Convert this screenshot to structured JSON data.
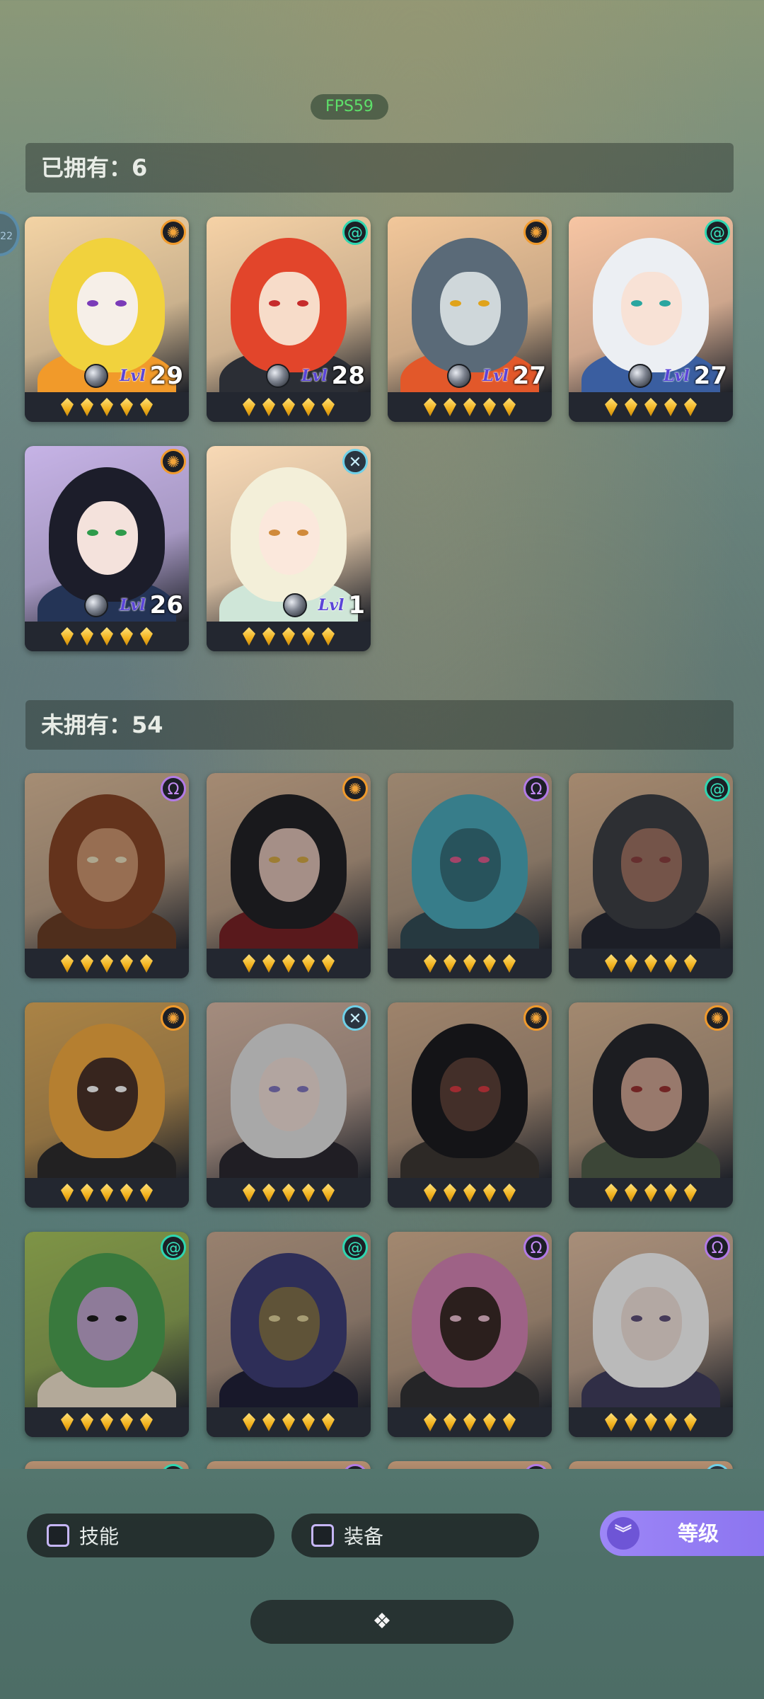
{
  "hud": {
    "fps": "FPS59",
    "side_badge": "22"
  },
  "owned": {
    "header": "已拥有：6",
    "heroes": [
      {
        "class_icon": "sun-icon",
        "level_label": "Lvl",
        "level": "29",
        "stars": 5,
        "palette": {
          "bg": "#f3d3a4",
          "hair": "#f1d23d",
          "face": "#f6efe8",
          "body": "#f19a2a",
          "eye": "#7b3bb8"
        }
      },
      {
        "class_icon": "swirl-icon",
        "level_label": "Lvl",
        "level": "28",
        "stars": 5,
        "palette": {
          "bg": "#f6d2a6",
          "hair": "#e2452b",
          "face": "#f7dcc9",
          "body": "#2b2e35",
          "eye": "#c62b2b"
        }
      },
      {
        "class_icon": "sun-icon",
        "level_label": "Lvl",
        "level": "27",
        "stars": 5,
        "palette": {
          "bg": "#f2c79a",
          "hair": "#5a6a78",
          "face": "#cfd7da",
          "body": "#e2582a",
          "eye": "#e0a31a"
        }
      },
      {
        "class_icon": "swirl-icon",
        "level_label": "Lvl",
        "level": "27",
        "stars": 5,
        "palette": {
          "bg": "#f7c5a3",
          "hair": "#eceff3",
          "face": "#f8e2d6",
          "body": "#3a5ea0",
          "eye": "#2aa6a0"
        }
      },
      {
        "class_icon": "sun-icon",
        "level_label": "Lvl",
        "level": "26",
        "stars": 5,
        "palette": {
          "bg": "#c6b3e6",
          "hair": "#1c1d2a",
          "face": "#f4e2dc",
          "body": "#243456",
          "eye": "#2e9b4b"
        }
      },
      {
        "class_icon": "cross-icon",
        "level_label": "Lvl",
        "level": "1",
        "stars": 5,
        "palette": {
          "bg": "#f8d9b5",
          "hair": "#f3efd9",
          "face": "#fbe8dc",
          "body": "#cfe6d8",
          "eye": "#d08a3a"
        }
      }
    ]
  },
  "unowned": {
    "header": "未拥有：54",
    "heroes": [
      {
        "class_icon": "void-icon",
        "stars": 5,
        "palette": {
          "bg": "#d9b48e",
          "hair": "#8a3f1c",
          "face": "#c98b62",
          "body": "#6b3a1f",
          "eye": "#e0d5b0"
        }
      },
      {
        "class_icon": "sun-icon",
        "stars": 5,
        "palette": {
          "bg": "#d7b08c",
          "hair": "#202024",
          "face": "#d8b7aa",
          "body": "#7e1d22",
          "eye": "#d0a031"
        }
      },
      {
        "class_icon": "void-icon",
        "stars": 5,
        "palette": {
          "bg": "#caa987",
          "hair": "#3aa3b7",
          "face": "#2b6c7a",
          "body": "#2d4a55",
          "eye": "#e2528a"
        }
      },
      {
        "class_icon": "swirl-icon",
        "stars": 5,
        "palette": {
          "bg": "#d6ad86",
          "hair": "#3a3c42",
          "face": "#9b6a5a",
          "body": "#242632",
          "eye": "#8c3a3a"
        }
      },
      {
        "class_icon": "sun-icon",
        "stars": 5,
        "palette": {
          "bg": "#e2a74a",
          "hair": "#f3a12b",
          "face": "#4a2f24",
          "body": "#2c2a2c",
          "eye": "#f0f0f0"
        }
      },
      {
        "class_icon": "cross-icon",
        "stars": 5,
        "palette": {
          "bg": "#d6b29c",
          "hair": "#d8d8d8",
          "face": "#e7d3cc",
          "body": "#2a2630",
          "eye": "#7b6fc0"
        }
      },
      {
        "class_icon": "sun-icon",
        "stars": 5,
        "palette": {
          "bg": "#cfa783",
          "hair": "#1a1a1e",
          "face": "#5a3b33",
          "body": "#3a3430",
          "eye": "#e0323a"
        }
      },
      {
        "class_icon": "sun-icon",
        "stars": 5,
        "palette": {
          "bg": "#d5ae88",
          "hair": "#24252b",
          "face": "#c99a86",
          "body": "#4c5a44",
          "eye": "#9e2b2b"
        }
      },
      {
        "class_icon": "swirl-icon",
        "stars": 5,
        "palette": {
          "bg": "#9fc04a",
          "hair": "#3f9f44",
          "face": "#b99cc9",
          "body": "#e8d9c0",
          "eye": "#1a1a1a"
        }
      },
      {
        "class_icon": "swirl-icon",
        "stars": 5,
        "palette": {
          "bg": "#c7a488",
          "hair": "#3b3a7a",
          "face": "#7d6a42",
          "body": "#1e1f3a",
          "eye": "#d8c88a"
        }
      },
      {
        "class_icon": "void-icon",
        "stars": 5,
        "palette": {
          "bg": "#d5ad88",
          "hair": "#d57ab0",
          "face": "#3a2724",
          "body": "#2f2f33",
          "eye": "#e4b3c8"
        }
      },
      {
        "class_icon": "void-icon",
        "stars": 5,
        "palette": {
          "bg": "#dcb595",
          "hair": "#eeeeee",
          "face": "#e8d7cf",
          "body": "#3e3a5e",
          "eye": "#5b4b7a"
        }
      }
    ],
    "partial_row_icons": [
      "swirl-icon",
      "void-icon",
      "void-icon",
      "cross-icon"
    ]
  },
  "filters": [
    {
      "label": "技能",
      "checked": false
    },
    {
      "label": "装备",
      "checked": false
    }
  ],
  "sort": {
    "label": "等级",
    "icon": "double-chevron-down-icon"
  },
  "bottom_bar": {
    "icon": "diamond-cluster-icon",
    "glyph": "❖"
  }
}
